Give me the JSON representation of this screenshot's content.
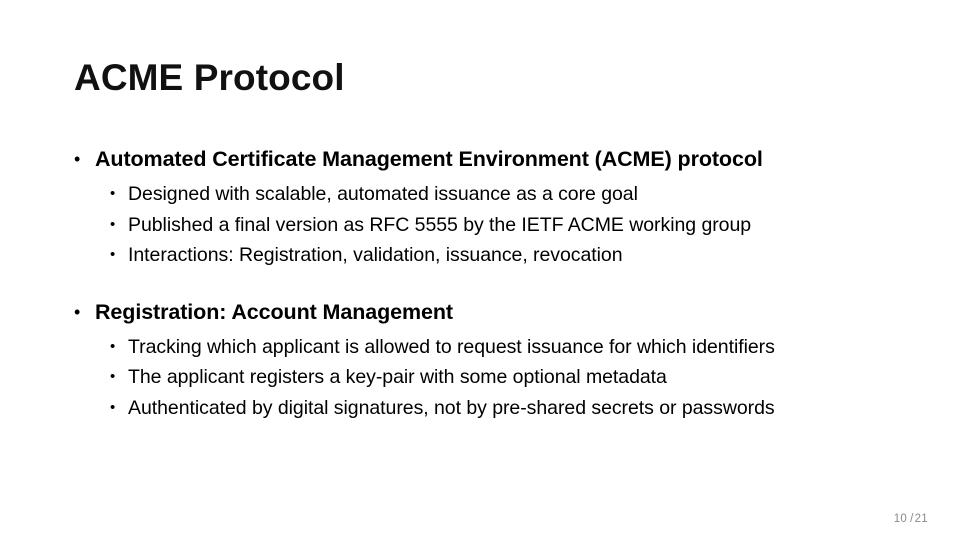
{
  "slide": {
    "title": "ACME Protocol",
    "background_color": "#ffffff",
    "text_color": "#000000",
    "page_number_color": "#8a8a8a",
    "bullet_glyph": "•"
  },
  "content": {
    "groups": [
      {
        "heading": "Automated Certificate Management Environment (ACME) protocol",
        "items": [
          "Designed with scalable, automated issuance as a core goal",
          "Published a final version as RFC 5555 by the IETF ACME working group",
          "Interactions: Registration, validation, issuance, revocation"
        ]
      },
      {
        "heading": "Registration: Account Management",
        "items": [
          "Tracking which applicant is allowed to request issuance for which identifiers",
          "The applicant registers a key-pair with some optional metadata",
          "Authenticated by digital signatures, not by pre-shared secrets or passwords"
        ]
      }
    ]
  },
  "footer": {
    "current_page": "10",
    "separator": "/",
    "total_pages": "21"
  }
}
